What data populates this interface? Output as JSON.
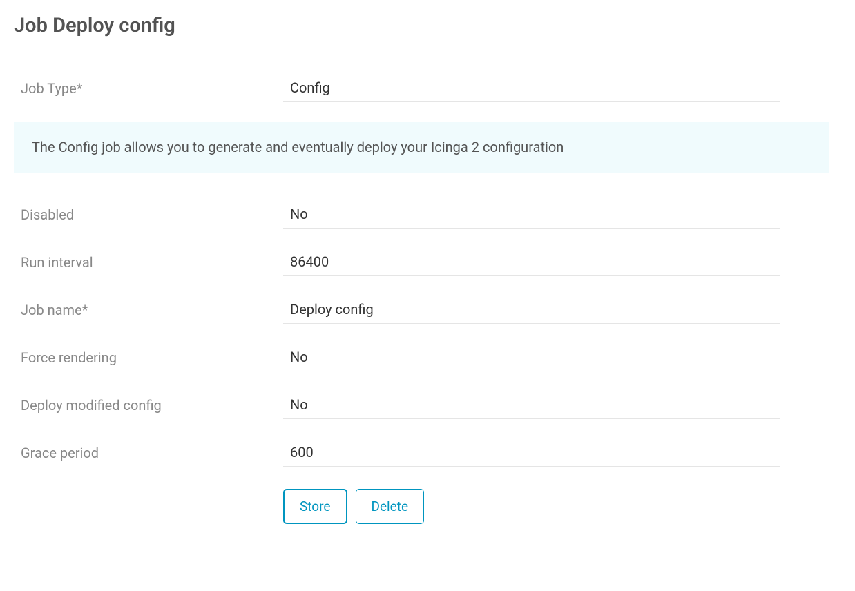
{
  "title": "Job Deploy config",
  "info_text": "The Config job allows you to generate and eventually deploy your Icinga 2 configuration",
  "fields": {
    "job_type": {
      "label": "Job Type*",
      "value": "Config"
    },
    "disabled": {
      "label": "Disabled",
      "value": "No"
    },
    "run_interval": {
      "label": "Run interval",
      "value": "86400"
    },
    "job_name": {
      "label": "Job name*",
      "value": "Deploy config"
    },
    "force_rendering": {
      "label": "Force rendering",
      "value": "No"
    },
    "deploy_modified_config": {
      "label": "Deploy modified config",
      "value": "No"
    },
    "grace_period": {
      "label": "Grace period",
      "value": "600"
    }
  },
  "buttons": {
    "store": "Store",
    "delete": "Delete"
  }
}
